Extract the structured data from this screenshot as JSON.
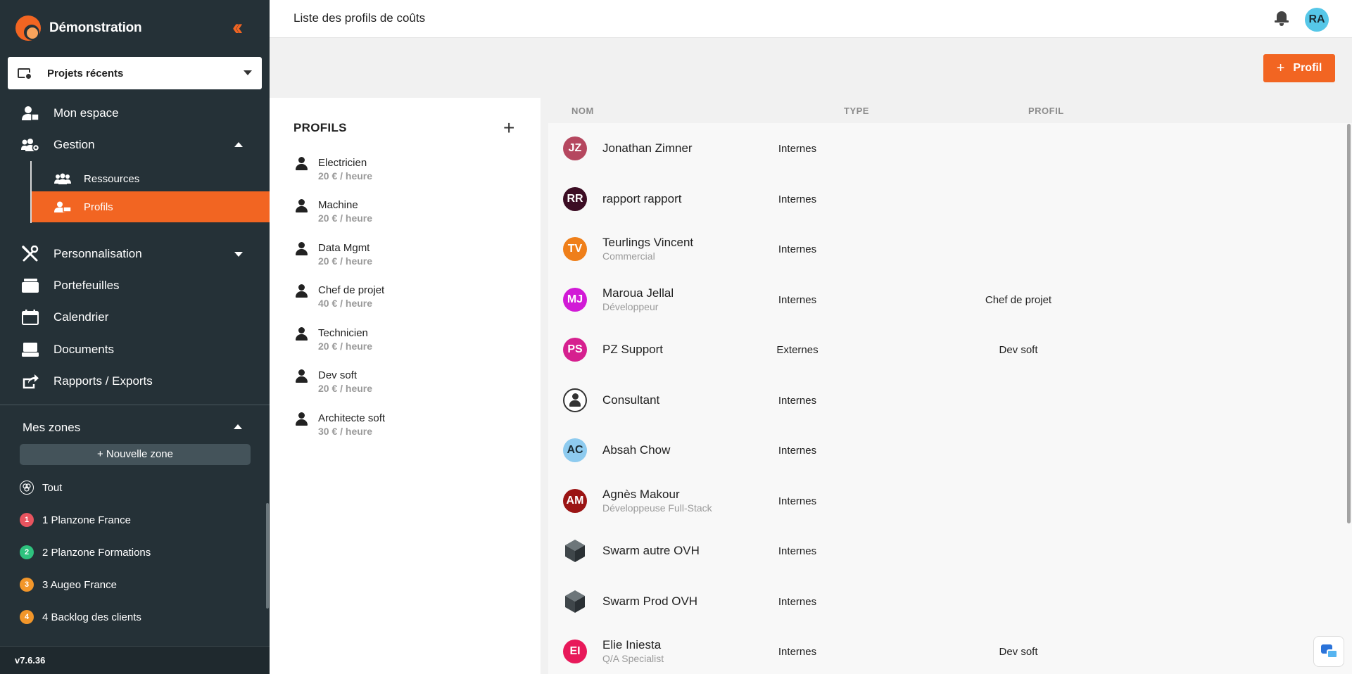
{
  "brand": {
    "title": "Démonstration",
    "accent": "#f26522"
  },
  "recent_projects": {
    "label": "Projets récents"
  },
  "nav": {
    "mon_espace": "Mon espace",
    "gestion": "Gestion",
    "ressources": "Ressources",
    "profils": "Profils",
    "personnalisation": "Personnalisation",
    "portefeuilles": "Portefeuilles",
    "calendrier": "Calendrier",
    "documents": "Documents",
    "rapports": "Rapports / Exports"
  },
  "zones": {
    "title": "Mes zones",
    "new_zone": "+ Nouvelle zone",
    "items": [
      {
        "badge": "",
        "label": "Tout",
        "color": ""
      },
      {
        "badge": "1",
        "label": "1 Planzone France",
        "color": "#e8545f"
      },
      {
        "badge": "2",
        "label": "2 Planzone Formations",
        "color": "#2ec27e"
      },
      {
        "badge": "3",
        "label": "3 Augeo France",
        "color": "#f2962a"
      },
      {
        "badge": "4",
        "label": "4 Backlog des clients",
        "color": "#f2962a"
      }
    ]
  },
  "version": "v7.6.36",
  "header": {
    "title": "Liste des profils de coûts",
    "user_initials": "RA"
  },
  "toolbar": {
    "add_profile_label": "Profil"
  },
  "profiles": {
    "title": "PROFILS",
    "items": [
      {
        "name": "Electricien",
        "rate": "20 € / heure"
      },
      {
        "name": "Machine",
        "rate": "20 € / heure"
      },
      {
        "name": "Data Mgmt",
        "rate": "20 € / heure"
      },
      {
        "name": "Chef de projet",
        "rate": "40 € / heure"
      },
      {
        "name": "Technicien",
        "rate": "20 € / heure"
      },
      {
        "name": "Dev soft",
        "rate": "20 € / heure"
      },
      {
        "name": "Architecte soft",
        "rate": "30 € / heure"
      }
    ]
  },
  "table": {
    "columns": {
      "name": "NOM",
      "type": "TYPE",
      "profile": "PROFIL"
    },
    "rows": [
      {
        "initials": "JZ",
        "color": "#b5475f",
        "name": "Jonathan Zimner",
        "subtitle": "",
        "type": "Internes",
        "profile": "",
        "icon": "avatar"
      },
      {
        "initials": "RR",
        "color": "#3c0d24",
        "name": "rapport rapport",
        "subtitle": "",
        "type": "Internes",
        "profile": "",
        "icon": "avatar"
      },
      {
        "initials": "TV",
        "color": "#ef7f1a",
        "name": "Teurlings Vincent",
        "subtitle": "Commercial",
        "type": "Internes",
        "profile": "",
        "icon": "avatar"
      },
      {
        "initials": "MJ",
        "color": "#d11ad6",
        "name": "Maroua Jellal",
        "subtitle": "Développeur",
        "type": "Internes",
        "profile": "Chef de projet",
        "icon": "avatar"
      },
      {
        "initials": "PS",
        "color": "#d6208f",
        "name": "PZ Support",
        "subtitle": "",
        "type": "Externes",
        "profile": "Dev soft",
        "icon": "avatar"
      },
      {
        "initials": "",
        "color": "",
        "name": "Consultant",
        "subtitle": "",
        "type": "Internes",
        "profile": "",
        "icon": "consultant-icon"
      },
      {
        "initials": "AC",
        "color": "#8ecbef",
        "name": "Absah Chow",
        "subtitle": "",
        "type": "Internes",
        "profile": "",
        "icon": "avatar"
      },
      {
        "initials": "AM",
        "color": "#9b1414",
        "name": "Agnès Makour",
        "subtitle": "Développeuse Full-Stack",
        "type": "Internes",
        "profile": "",
        "icon": "avatar"
      },
      {
        "initials": "",
        "color": "",
        "name": "Swarm autre OVH",
        "subtitle": "",
        "type": "Internes",
        "profile": "",
        "icon": "cube-icon"
      },
      {
        "initials": "",
        "color": "",
        "name": "Swarm Prod OVH",
        "subtitle": "",
        "type": "Internes",
        "profile": "",
        "icon": "cube-icon"
      },
      {
        "initials": "EI",
        "color": "#e8195a",
        "name": "Elie Iniesta",
        "subtitle": "Q/A Specialist",
        "type": "Internes",
        "profile": "Dev soft",
        "icon": "avatar"
      }
    ]
  }
}
